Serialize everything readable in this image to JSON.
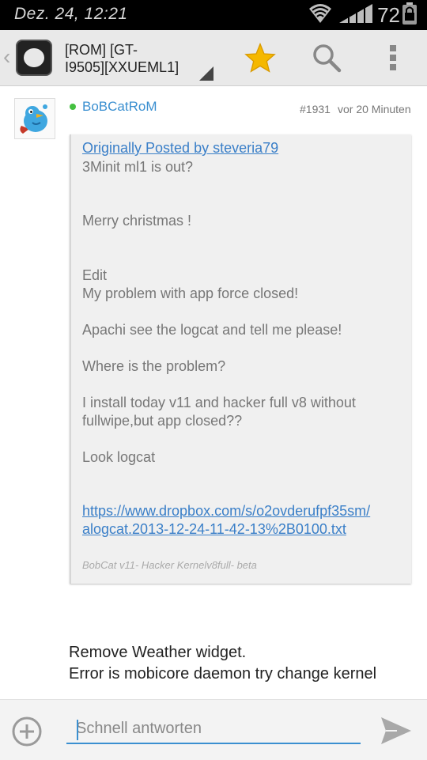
{
  "status_bar": {
    "time": "Dez. 24, 12:21",
    "battery": "72",
    "icons": [
      "wifi-icon",
      "signal-icon",
      "battery-icon"
    ]
  },
  "action_bar": {
    "title_line1": "[ROM] [GT-",
    "title_line2": "I9505][XXUEML1]",
    "icons": [
      "up-caret-icon",
      "app-icon",
      "star-icon",
      "search-icon",
      "overflow-menu-icon"
    ],
    "accent": "#f5b800"
  },
  "post": {
    "username": "BoBCatRoM",
    "post_number": "#1931",
    "time_ago": "vor 20 Minuten",
    "online_color": "#44c040",
    "quote": {
      "header": "Originally Posted by steveria79",
      "lines": [
        "3Minit ml1 is out?",
        "Merry christmas !",
        "Edit",
        "My problem with app force closed!",
        "Apachi see the logcat and tell me please!",
        "Where is the problem?",
        "I install today v11 and hacker full v8 without",
        "fullwipe,but app closed??",
        "Look logcat"
      ],
      "link_line1": "https://www.dropbox.com/s/o2ovderufpf35sm/",
      "link_line2": "alogcat.2013-12-24-11-42-13%2B0100.txt",
      "signature": "BobCat v11- Hacker Kernelv8full- beta"
    },
    "reply_lines": [
      "Remove Weather widget.",
      "Error is mobicore daemon try change kernel"
    ]
  },
  "bottom_bar": {
    "placeholder": "Schnell antworten",
    "value": "",
    "link_color": "#3a8fd0"
  }
}
